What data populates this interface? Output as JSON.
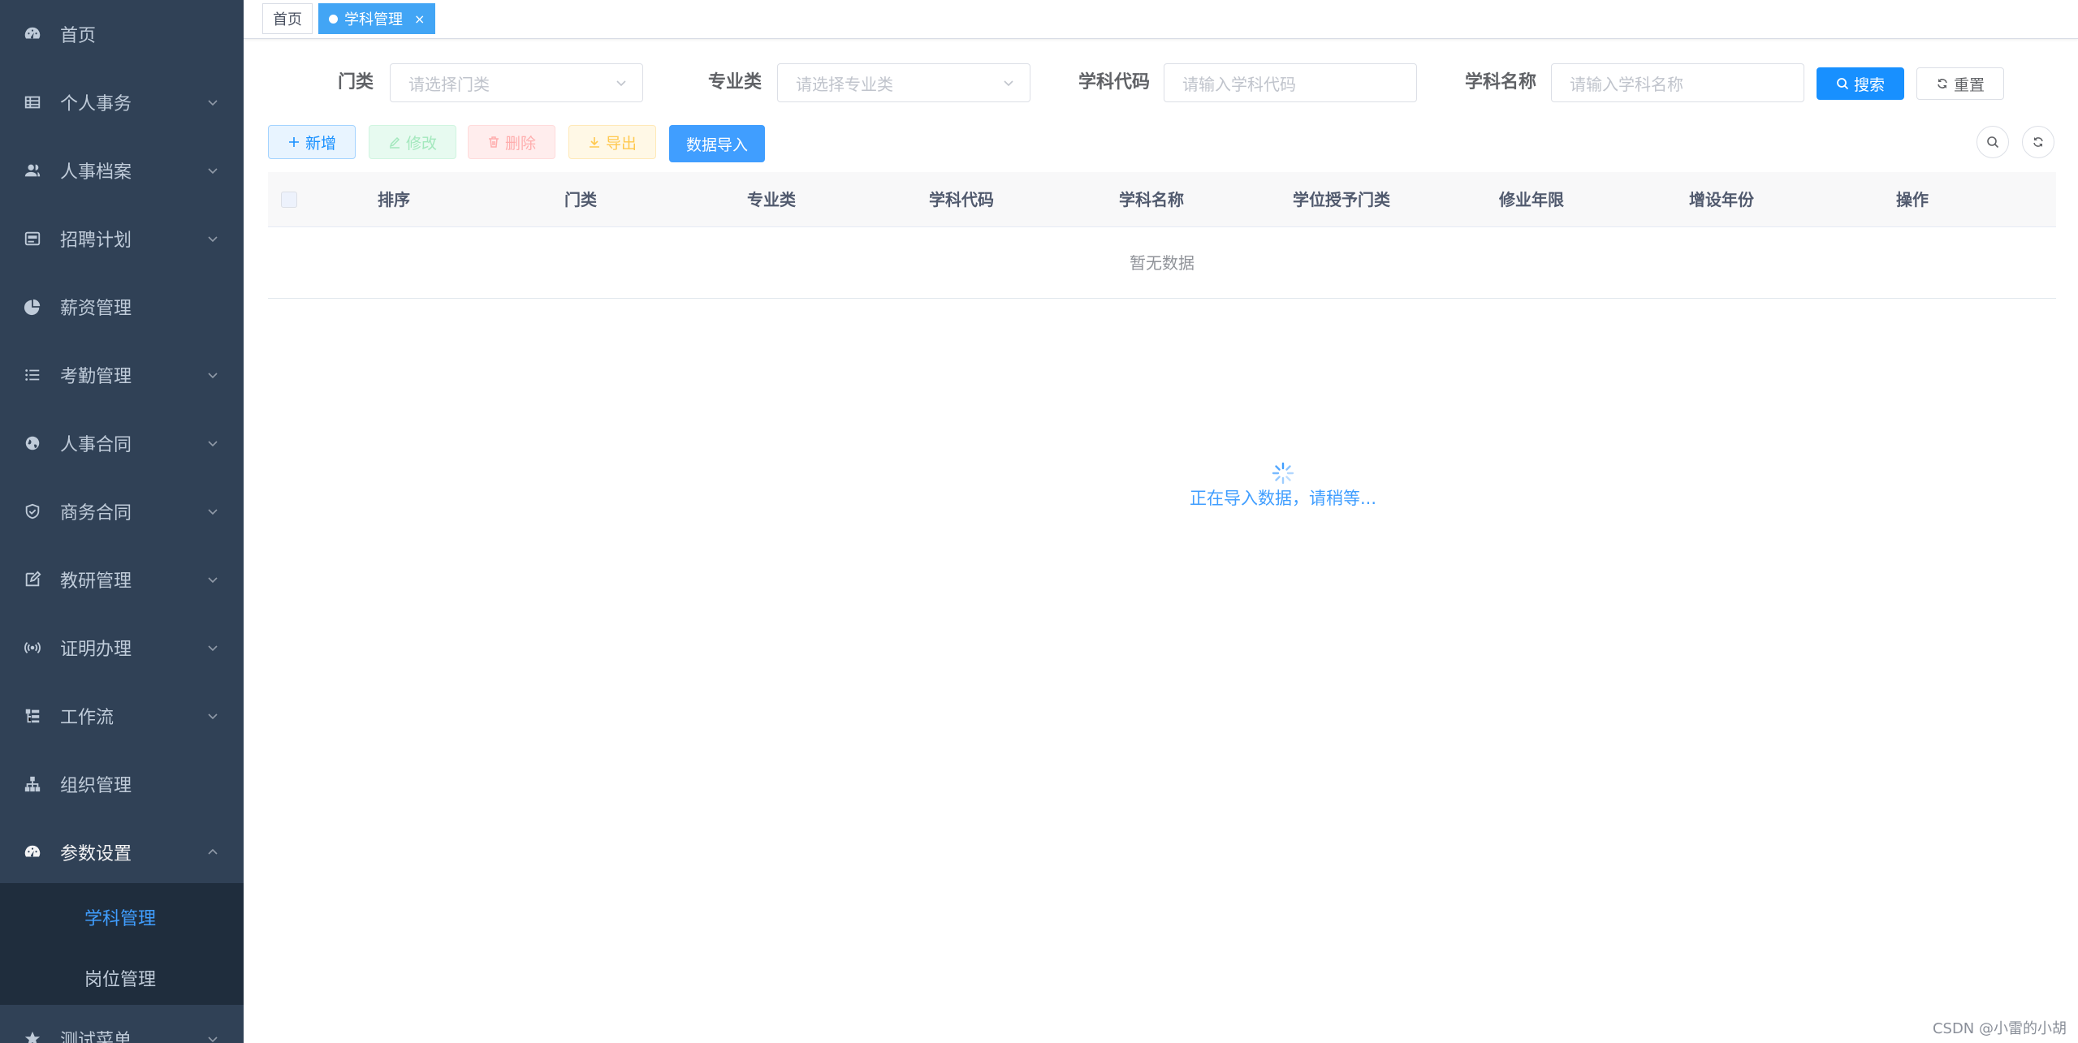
{
  "sidebar": {
    "items": [
      {
        "label": "首页",
        "icon": "dashboard-icon",
        "has_arrow": false
      },
      {
        "label": "个人事务",
        "icon": "table-icon",
        "has_arrow": true
      },
      {
        "label": "人事档案",
        "icon": "peoples-icon",
        "has_arrow": true
      },
      {
        "label": "招聘计划",
        "icon": "form-icon",
        "has_arrow": true
      },
      {
        "label": "薪资管理",
        "icon": "chart-icon",
        "has_arrow": false
      },
      {
        "label": "考勤管理",
        "icon": "list-icon",
        "has_arrow": true
      },
      {
        "label": "人事合同",
        "icon": "international-icon",
        "has_arrow": true
      },
      {
        "label": "商务合同",
        "icon": "validcode-icon",
        "has_arrow": true
      },
      {
        "label": "教研管理",
        "icon": "edit-icon",
        "has_arrow": true
      },
      {
        "label": "证明办理",
        "icon": "radio-icon",
        "has_arrow": true
      },
      {
        "label": "工作流",
        "icon": "tree-table-icon",
        "has_arrow": true
      },
      {
        "label": "组织管理",
        "icon": "tree-icon",
        "has_arrow": false
      },
      {
        "label": "参数设置",
        "icon": "dashboard-icon",
        "has_arrow": true,
        "expanded": true
      }
    ],
    "submenu": [
      {
        "label": "学科管理",
        "active": true
      },
      {
        "label": "岗位管理",
        "active": false
      }
    ],
    "last_item": {
      "label": "测试菜单",
      "icon": "star-icon"
    }
  },
  "tags": {
    "home": "首页",
    "current": "学科管理",
    "close": "×"
  },
  "search": {
    "category_label": "门类",
    "category_placeholder": "请选择门类",
    "major_label": "专业类",
    "major_placeholder": "请选择专业类",
    "code_label": "学科代码",
    "code_placeholder": "请输入学科代码",
    "name_label": "学科名称",
    "name_placeholder": "请输入学科名称",
    "search_btn": "搜索",
    "reset_btn": "重置"
  },
  "toolbar": {
    "add": "新增",
    "edit": "修改",
    "delete": "删除",
    "export": "导出",
    "import": "数据导入"
  },
  "table": {
    "columns": [
      "排序",
      "门类",
      "专业类",
      "学科代码",
      "学科名称",
      "学位授予门类",
      "修业年限",
      "增设年份",
      "操作"
    ],
    "empty_text": "暂无数据"
  },
  "loading": {
    "text": "正在导入数据，请稍等..."
  },
  "watermark": "CSDN @小雷的小胡",
  "colors": {
    "sidebar_bg": "#304156",
    "submenu_bg": "#1f2d3d",
    "primary": "#409eff",
    "tag_active": "#42a5f5"
  }
}
